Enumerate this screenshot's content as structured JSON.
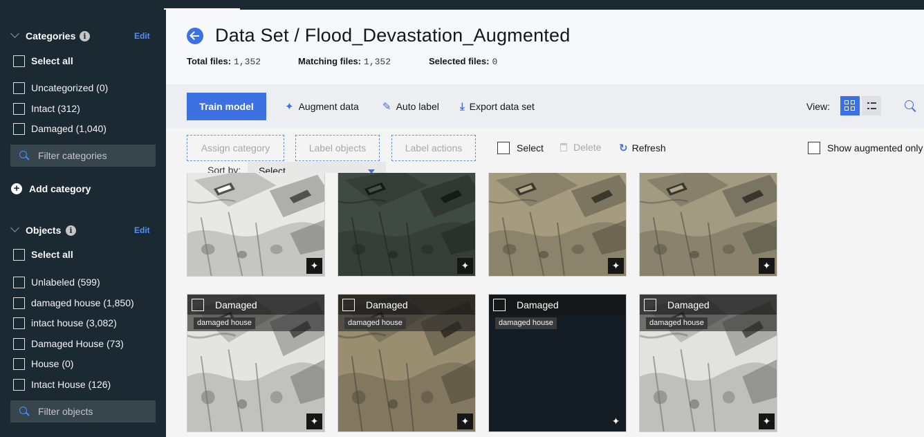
{
  "header": {
    "title": "Data Set / Flood_Devastation_Augmented",
    "total_files_label": "Total files:",
    "total_files": "1,352",
    "matching_files_label": "Matching files:",
    "matching_files": "1,352",
    "selected_files_label": "Selected files:",
    "selected_files": "0"
  },
  "sidebar": {
    "categories": {
      "title": "Categories",
      "edit": "Edit",
      "select_all": "Select all",
      "items": [
        "Uncategorized (0)",
        "Intact (312)",
        "Damaged (1,040)"
      ],
      "filter_placeholder": "Filter categories",
      "add": "Add category"
    },
    "objects": {
      "title": "Objects",
      "edit": "Edit",
      "select_all": "Select all",
      "items": [
        "Unlabeled (599)",
        "damaged house (1,850)",
        "intact house (3,082)",
        "Damaged House (73)",
        "House (0)",
        "Intact House (126)"
      ],
      "filter_placeholder": "Filter objects"
    }
  },
  "toolbar": {
    "train": "Train model",
    "augment": "Augment data",
    "auto_label": "Auto label",
    "export": "Export data set",
    "view_label": "View:"
  },
  "actions": {
    "assign_category": "Assign category",
    "label_objects": "Label objects",
    "label_actions": "Label actions",
    "select": "Select",
    "delete": "Delete",
    "refresh": "Refresh",
    "show_augmented": "Show augmented only",
    "sort_by": "Sort by:",
    "sort_value": "Select"
  },
  "gallery": {
    "row1": [
      {
        "tone": "#e8e8e6"
      },
      {
        "tone": "#3f4a44"
      },
      {
        "tone": "#a59c7f"
      },
      {
        "tone": "#a29b82"
      }
    ],
    "row2": [
      {
        "category": "Damaged",
        "tag": "damaged house",
        "tone": "#e4e4e2"
      },
      {
        "category": "Damaged",
        "tag": "damaged house",
        "tone": "#9a8e71"
      },
      {
        "category": "Damaged",
        "tag": "damaged house",
        "tone": "#121c22"
      },
      {
        "category": "Damaged",
        "tag": "damaged house",
        "tone": "#e2e2e0"
      }
    ]
  }
}
